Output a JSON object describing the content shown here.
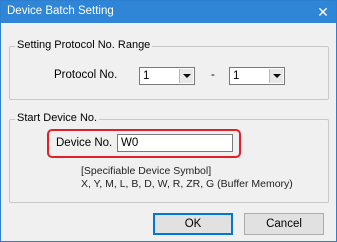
{
  "window": {
    "title": "Device Batch Setting",
    "close_glyph": "✕"
  },
  "protocol_range": {
    "legend": "Setting Protocol No. Range",
    "label": "Protocol No.",
    "from_value": "1",
    "separator": "-",
    "to_value": "1"
  },
  "start_device": {
    "legend": "Start Device No.",
    "label": "Device No.",
    "value": "W0",
    "note_line1": "[Specifiable Device Symbol]",
    "note_line2": "X, Y, M, L, B, D, W, R, ZR, G (Buffer Memory)"
  },
  "buttons": {
    "ok": "OK",
    "cancel": "Cancel"
  },
  "colors": {
    "title_bar": "#2f86d6",
    "highlight": "#e0202a"
  }
}
